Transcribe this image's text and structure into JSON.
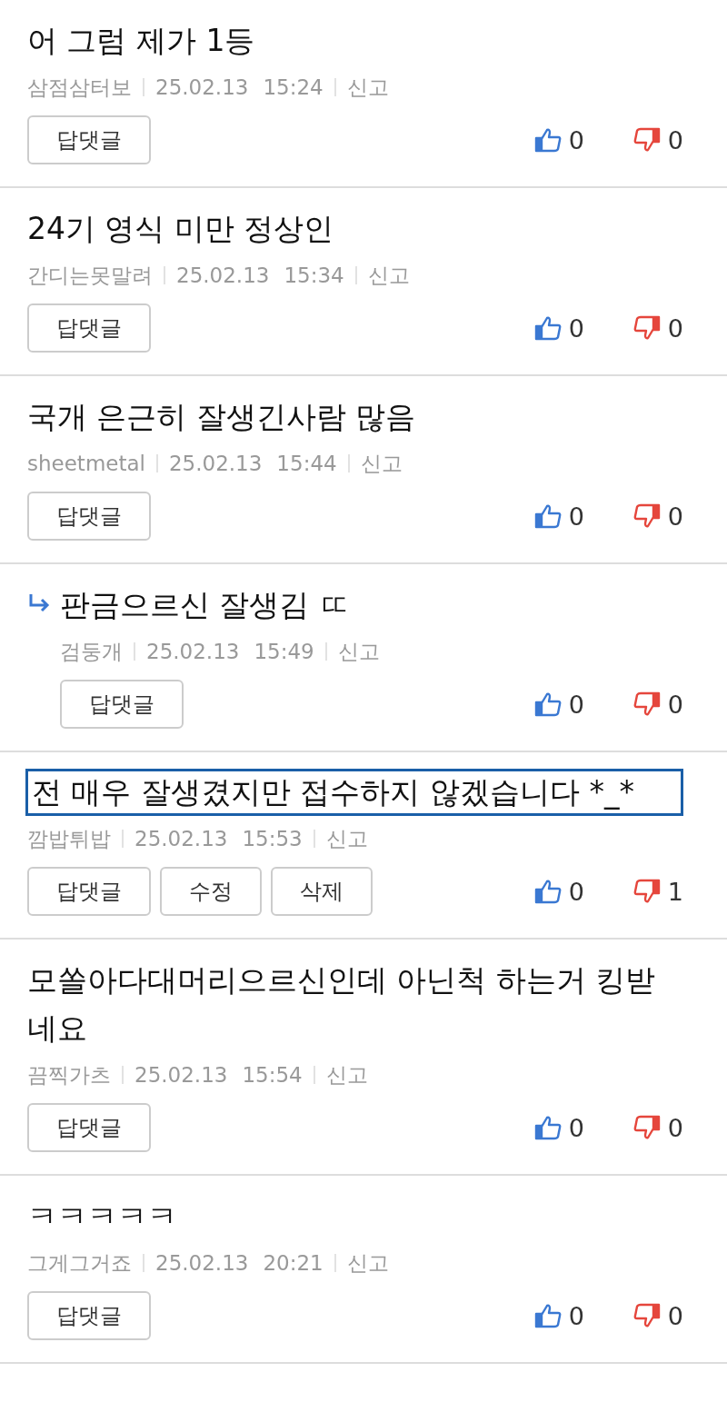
{
  "comments": [
    {
      "reply": false,
      "focused": false,
      "text": "어 그럼 제가 1등",
      "author": "삼점삼터보",
      "date": "25.02.13",
      "time": "15:24",
      "report": "신고",
      "buttons": [
        "답댓글"
      ],
      "likes": "0",
      "dislikes": "0"
    },
    {
      "reply": false,
      "focused": false,
      "text": "24기 영식 미만 정상인",
      "author": "간디는못말려",
      "date": "25.02.13",
      "time": "15:34",
      "report": "신고",
      "buttons": [
        "답댓글"
      ],
      "likes": "0",
      "dislikes": "0"
    },
    {
      "reply": false,
      "focused": false,
      "text": "국개 은근히 잘생긴사람 많음",
      "author": "sheetmetal",
      "date": "25.02.13",
      "time": "15:44",
      "report": "신고",
      "buttons": [
        "답댓글"
      ],
      "likes": "0",
      "dislikes": "0"
    },
    {
      "reply": true,
      "focused": false,
      "text": "판금으르신 잘생김 ㄸ",
      "author": "검둥개",
      "date": "25.02.13",
      "time": "15:49",
      "report": "신고",
      "buttons": [
        "답댓글"
      ],
      "likes": "0",
      "dislikes": "0"
    },
    {
      "reply": false,
      "focused": true,
      "text": "전 매우 잘생겼지만 접수하지 않겠습니다 *_*",
      "author": "깜밥튀밥",
      "date": "25.02.13",
      "time": "15:53",
      "report": "신고",
      "buttons": [
        "답댓글",
        "수정",
        "삭제"
      ],
      "likes": "0",
      "dislikes": "1"
    },
    {
      "reply": false,
      "focused": false,
      "text": "모쏠아다대머리으르신인데 아닌척 하는거 킹받네요",
      "author": "끔찍가츠",
      "date": "25.02.13",
      "time": "15:54",
      "report": "신고",
      "buttons": [
        "답댓글"
      ],
      "likes": "0",
      "dislikes": "0"
    },
    {
      "reply": false,
      "focused": false,
      "text": "ㅋㅋㅋㅋㅋ",
      "author": "그게그거죠",
      "date": "25.02.13",
      "time": "20:21",
      "report": "신고",
      "buttons": [
        "답댓글"
      ],
      "likes": "0",
      "dislikes": "0"
    }
  ]
}
